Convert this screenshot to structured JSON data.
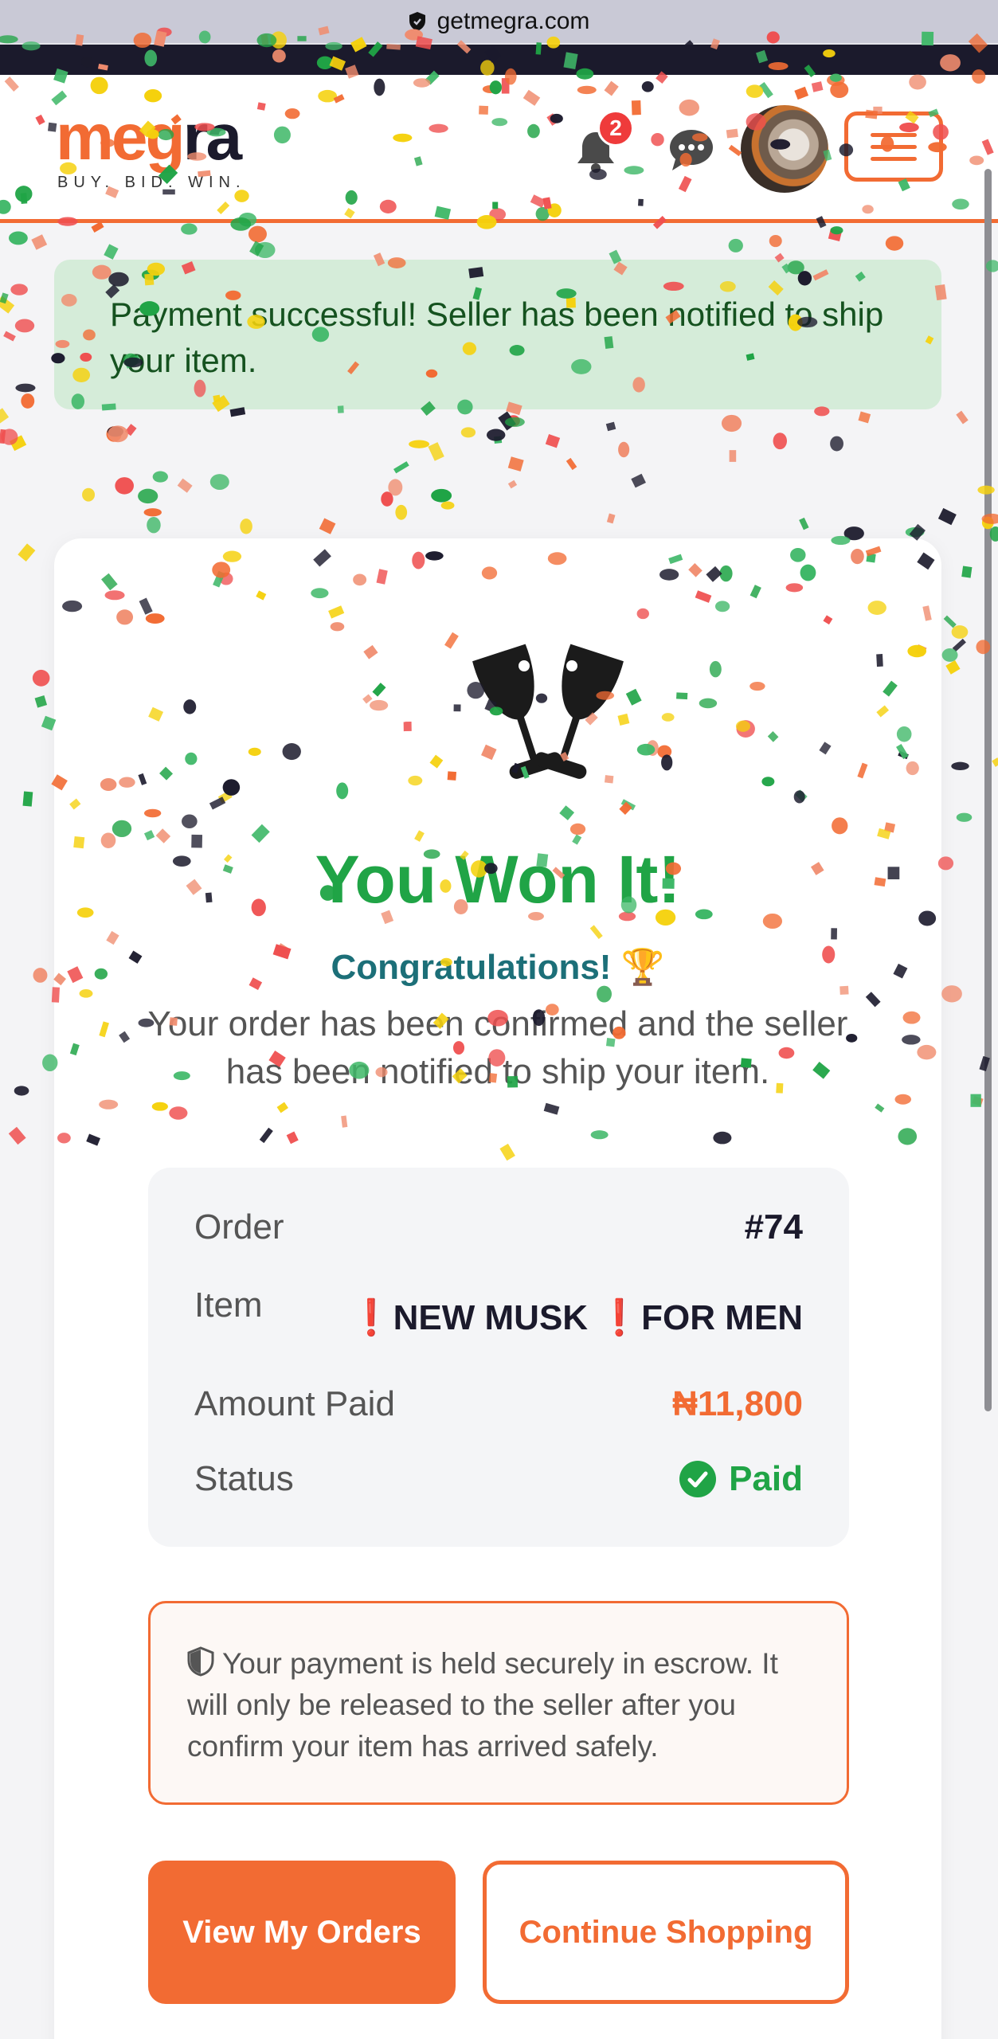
{
  "browser": {
    "url": "getmegra.com"
  },
  "header": {
    "logo_part1": "meg",
    "logo_part2": "ra",
    "tagline": "BUY. BID. WIN.",
    "notification_count": "2"
  },
  "alert": {
    "message": "Payment successful! Seller has been notified to ship your item."
  },
  "hero": {
    "title": "You Won It!",
    "subtitle": "Congratulations!",
    "trophy": "🏆",
    "description": "Your order has been confirmed and the seller has been notified to ship your item."
  },
  "summary": {
    "order_label": "Order",
    "order_value": "#74",
    "item_label": "Item",
    "item_excl": "❗",
    "item_part1": "NEW MUSK",
    "item_part2": "FOR MEN",
    "amount_label": "Amount Paid",
    "amount_value": "₦11,800",
    "status_label": "Status",
    "status_value": "Paid"
  },
  "escrow": {
    "message": "Your payment is held securely in escrow. It will only be released to the seller after you confirm your item has arrived safely."
  },
  "actions": {
    "view_orders": "View My Orders",
    "continue_shopping": "Continue Shopping"
  },
  "colors": {
    "brand_orange": "#f26b33",
    "success_green": "#20a446",
    "alert_bg": "#d5ecd9"
  },
  "icons": [
    "shield-icon",
    "bell-icon",
    "chat-icon",
    "menu-icon",
    "cheers-icon",
    "trophy-icon",
    "check-circle-icon"
  ]
}
